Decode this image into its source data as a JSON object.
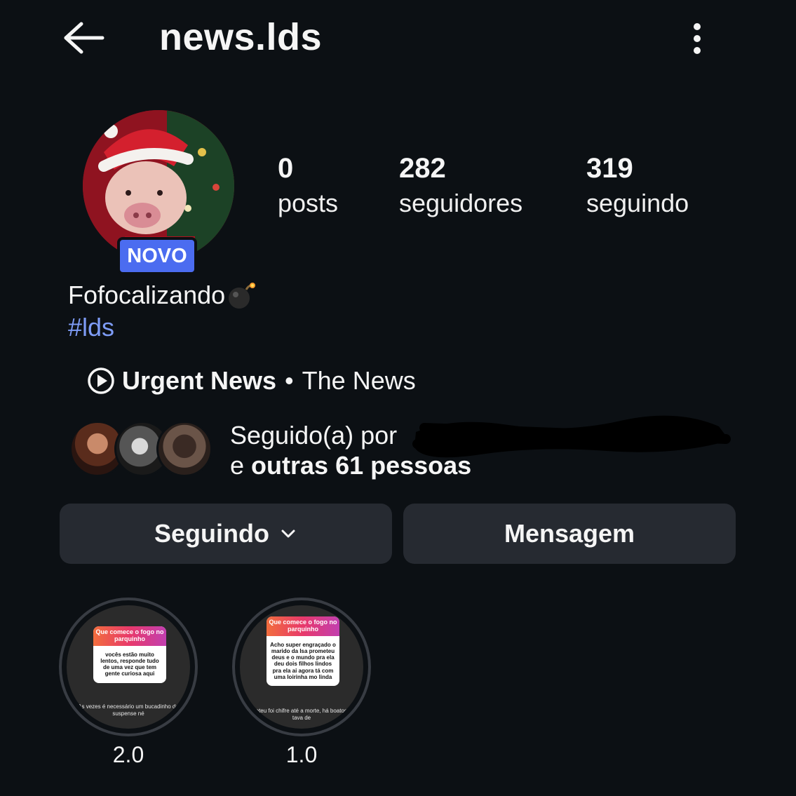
{
  "header": {
    "title": "news.lds",
    "back_icon": "arrow-left-icon",
    "more_icon": "more-vertical-icon"
  },
  "profile": {
    "badge": "NOVO",
    "bio_text": "Fofocalizando",
    "bio_emoji": "bomb-icon",
    "bio_hashtag": "#lds"
  },
  "stats": [
    {
      "value": "0",
      "label": "posts"
    },
    {
      "value": "282",
      "label": "seguidores"
    },
    {
      "value": "319",
      "label": "seguindo"
    }
  ],
  "music": {
    "icon": "play-circle-icon",
    "title": "Urgent News",
    "separator": "•",
    "artist": "The News"
  },
  "followed_by": {
    "prefix": "Seguido(a) por",
    "suffix_pre": "e",
    "suffix_bold": "outras 61 pessoas"
  },
  "buttons": {
    "following_label": "Seguindo",
    "message_label": "Mensagem"
  },
  "highlights": [
    {
      "label": "2.0",
      "card_header": "Que comece o fogo no parquinho",
      "card_body": "vocês estão muito lentos, responde tudo de uma vez que tem gente curiosa aqui",
      "footer": "As vezes é necessário um bucadinho de suspense né"
    },
    {
      "label": "1.0",
      "card_header": "Que comece o fogo no parquinho",
      "card_body": "Acho super engraçado o marido da Isa prometeu deus e o mundo pra ela deu dois filhos lindos pra ela ai agora tá com uma loirinha mo linda",
      "footer": "Prometeu foi chifre até a morte, há boatos q ele tava de"
    }
  ],
  "colors": {
    "background": "#0c1014",
    "button": "#262a31",
    "badge": "#4b6cf0",
    "hashtag": "#7e9cf6"
  }
}
